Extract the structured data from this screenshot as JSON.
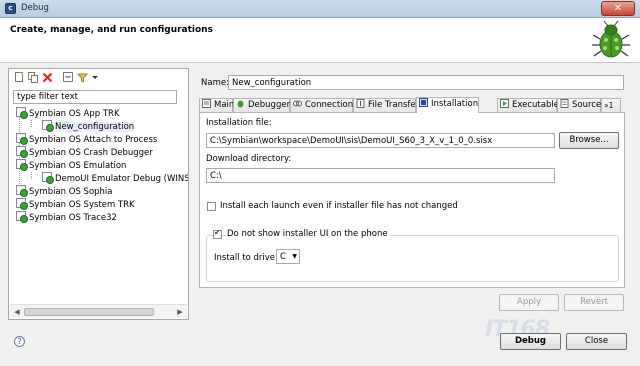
{
  "window": {
    "title": "Debug",
    "app_icon": "c",
    "close_glyph": "✕"
  },
  "banner": {
    "heading": "Create, manage, and run configurations",
    "icon": "debug-bug-icon"
  },
  "sidebar": {
    "toolbar_icons": [
      "new-launch-configuration-icon",
      "duplicate-icon",
      "delete-icon",
      "collapse-all-icon",
      "filter-icon",
      "dropdown-arrow-icon"
    ],
    "filter_placeholder": "type filter text",
    "tree": [
      {
        "label": "Symbian OS App TRK",
        "level": 0
      },
      {
        "label": "New_configuration",
        "level": 1,
        "selected": true
      },
      {
        "label": "Symbian OS Attach to Process",
        "level": 0
      },
      {
        "label": "Symbian OS Crash Debugger",
        "level": 0
      },
      {
        "label": "Symbian OS Emulation",
        "level": 0
      },
      {
        "label": "DemoUI Emulator Debug (WINSC",
        "level": 1
      },
      {
        "label": "Symbian OS Sophia",
        "level": 0
      },
      {
        "label": "Symbian OS System TRK",
        "level": 0
      },
      {
        "label": "Symbian OS Trace32",
        "level": 0
      }
    ]
  },
  "editor": {
    "name_label": "Name:",
    "name_value": "New_configuration",
    "tabs": [
      {
        "label": "Main",
        "icon": "main-tab-icon"
      },
      {
        "label": "Debugger",
        "icon": "debugger-tab-icon"
      },
      {
        "label": "Connection",
        "icon": "connection-tab-icon"
      },
      {
        "label": "File Transfer",
        "icon": "file-transfer-tab-icon"
      },
      {
        "label": "Installation",
        "icon": "installation-tab-icon",
        "active": true
      },
      {
        "label": "Executables",
        "icon": "executables-tab-icon"
      },
      {
        "label": "Source",
        "icon": "source-tab-icon"
      },
      {
        "label": "»1",
        "icon": "more-tabs-icon"
      }
    ],
    "installation": {
      "file_label": "Installation file:",
      "file_value": "C:\\Symbian\\workspace\\DemoUI\\sis\\DemoUI_S60_3_X_v_1_0_0.sisx",
      "browse_label": "Browse...",
      "download_label": "Download directory:",
      "download_value": "C:\\",
      "install_each_launch_label": "Install each launch even if installer file has not changed",
      "install_each_launch_checked": false,
      "no_installer_ui_label": "Do not show installer UI on the phone",
      "no_installer_ui_checked": true,
      "install_drive_label": "Install to drive:",
      "install_drive_value": "C"
    },
    "apply_label": "Apply",
    "revert_label": "Revert"
  },
  "footer": {
    "help_glyph": "?",
    "debug_label": "Debug",
    "close_label": "Close"
  },
  "watermark": "IT168"
}
